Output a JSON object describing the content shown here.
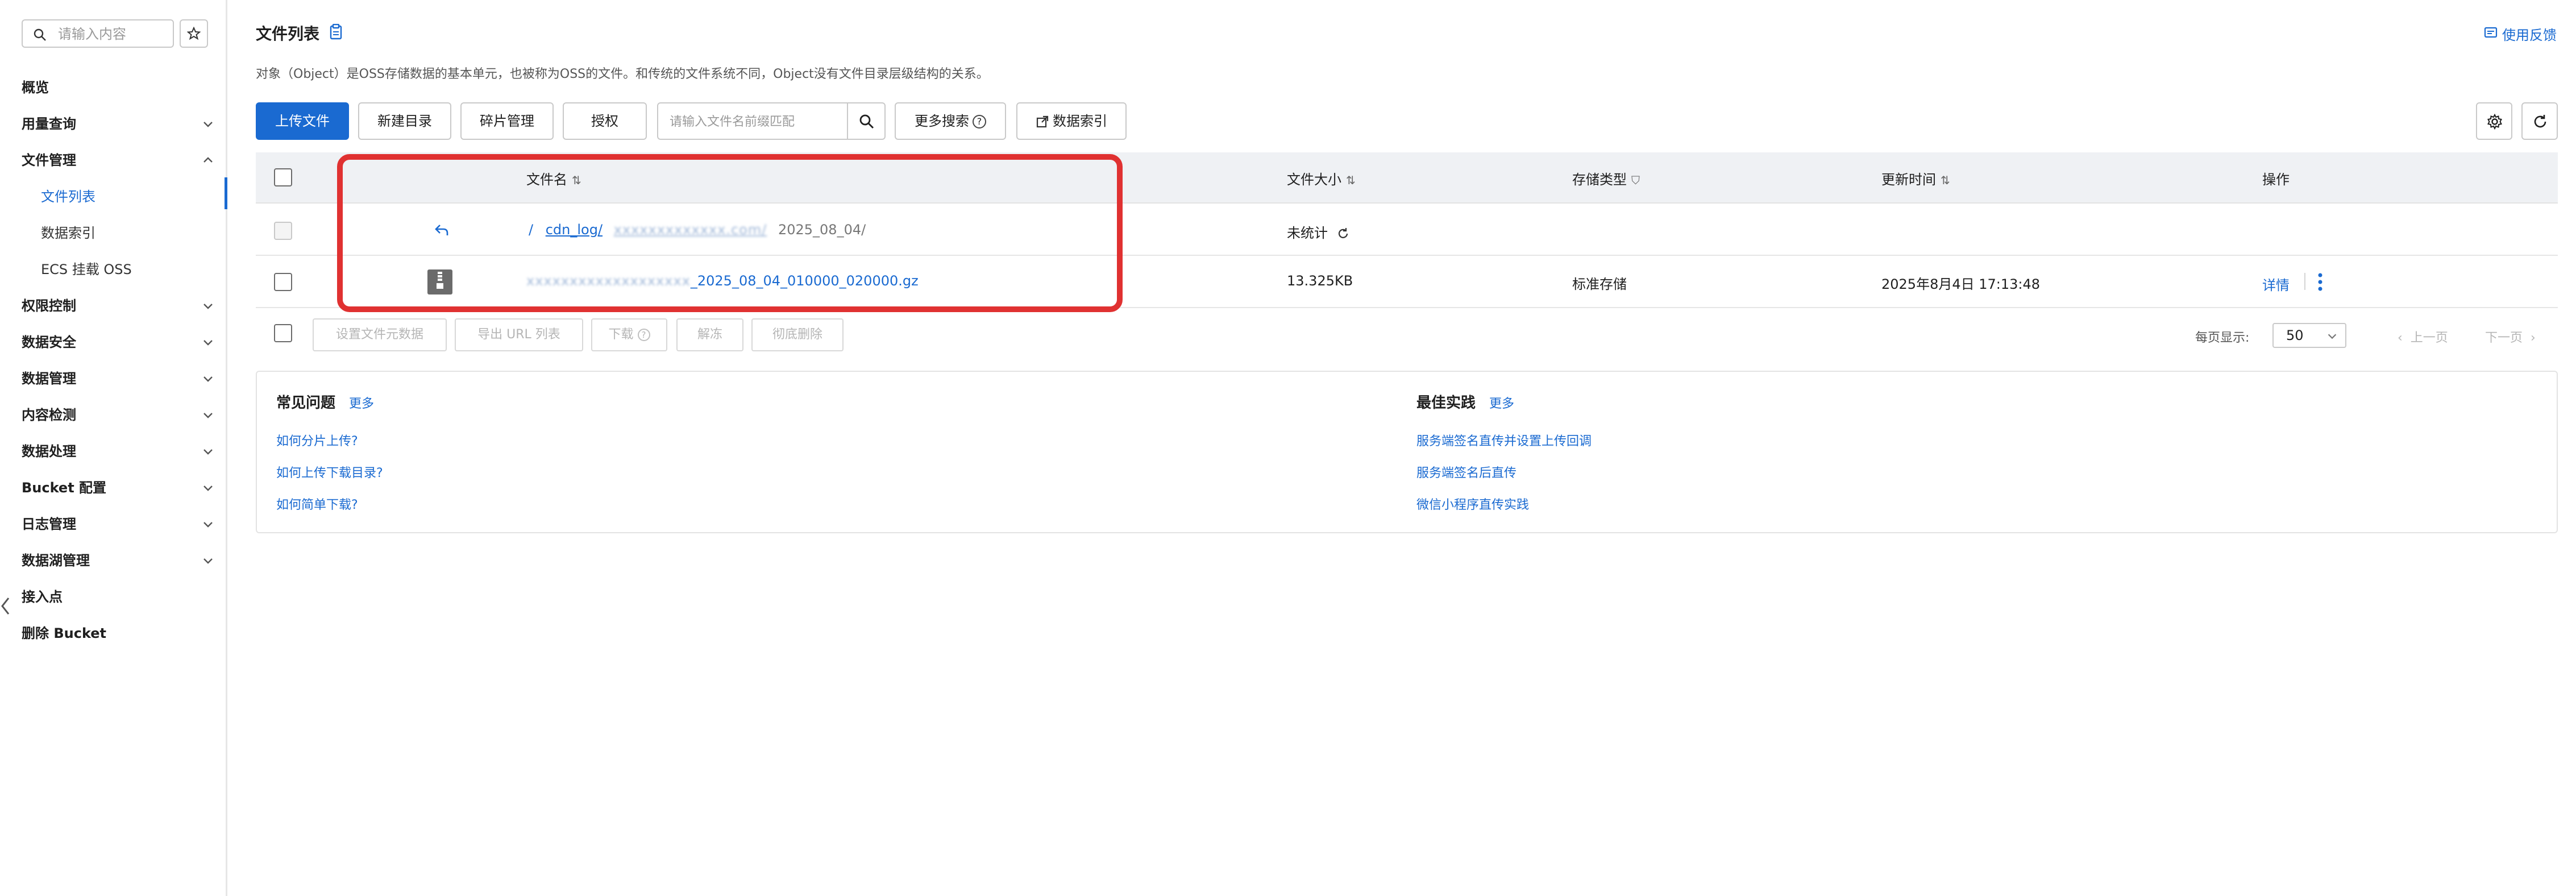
{
  "sidebar": {
    "search_placeholder": "请输入内容",
    "items": [
      {
        "label": "概览"
      },
      {
        "label": "用量查询"
      },
      {
        "label": "文件管理"
      },
      {
        "label": "文件列表"
      },
      {
        "label": "数据索引"
      },
      {
        "label": "ECS 挂载 OSS"
      },
      {
        "label": "权限控制"
      },
      {
        "label": "数据安全"
      },
      {
        "label": "数据管理"
      },
      {
        "label": "内容检测"
      },
      {
        "label": "数据处理"
      },
      {
        "label": "Bucket 配置"
      },
      {
        "label": "日志管理"
      },
      {
        "label": "数据湖管理"
      },
      {
        "label": "接入点"
      },
      {
        "label": "删除 Bucket"
      }
    ]
  },
  "header": {
    "title": "文件列表",
    "feedback": "使用反馈",
    "intro": "对象（Object）是OSS存储数据的基本单元，也被称为OSS的文件。和传统的文件系统不同，Object没有文件目录层级结构的关系。"
  },
  "toolbar": {
    "upload": "上传文件",
    "new_dir": "新建目录",
    "fragments": "碎片管理",
    "authorize": "授权",
    "search_placeholder": "请输入文件名前缀匹配",
    "more_search": "更多搜索",
    "data_index": "数据索引"
  },
  "table": {
    "columns": [
      "文件名",
      "文件大小",
      "存储类型",
      "更新时间",
      "操作"
    ],
    "path_row": {
      "root": "/",
      "seg1": "cdn_log/",
      "seg2": "xxxxxxxxxxxxx.com/",
      "seg3": "2025_08_04/",
      "size": "未统计"
    },
    "rows": [
      {
        "name_blurred": "xxxxxxxxxxxxxxxxxxx",
        "name": "_2025_08_04_010000_020000.gz",
        "size": "13.325KB",
        "storage": "标准存储",
        "updated": "2025年8月4日 17:13:48",
        "action": "详情"
      }
    ]
  },
  "footer": {
    "buttons": [
      "设置文件元数据",
      "导出 URL 列表",
      "下载",
      "解冻",
      "彻底删除"
    ],
    "page_size_label": "每页显示:",
    "page_size": "50",
    "prev": "上一页",
    "next": "下一页"
  },
  "help": {
    "faq_title": "常见问题",
    "faq_more": "更多",
    "faq_links": [
      "如何分片上传?",
      "如何上传下载目录?",
      "如何简单下载?"
    ],
    "best_title": "最佳实践",
    "best_more": "更多",
    "best_links": [
      "服务端签名直传并设置上传回调",
      "服务端签名后直传",
      "微信小程序直传实践"
    ]
  },
  "colors": {
    "accent": "#1a6ad1",
    "highlight": "#e03131"
  }
}
